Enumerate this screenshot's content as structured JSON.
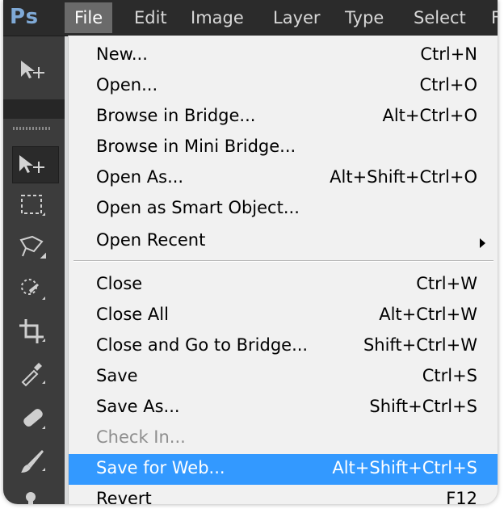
{
  "app": {
    "logo": "Ps"
  },
  "menubar": {
    "items": [
      {
        "label": "File",
        "active": true
      },
      {
        "label": "Edit"
      },
      {
        "label": "Image"
      },
      {
        "label": "Layer"
      },
      {
        "label": "Type"
      },
      {
        "label": "Select"
      },
      {
        "label": "F"
      }
    ]
  },
  "menu": {
    "group1": [
      {
        "label": "New...",
        "shortcut": "Ctrl+N"
      },
      {
        "label": "Open...",
        "shortcut": "Ctrl+O"
      },
      {
        "label": "Browse in Bridge...",
        "shortcut": "Alt+Ctrl+O"
      },
      {
        "label": "Browse in Mini Bridge...",
        "shortcut": ""
      },
      {
        "label": "Open As...",
        "shortcut": "Alt+Shift+Ctrl+O"
      },
      {
        "label": "Open as Smart Object...",
        "shortcut": ""
      },
      {
        "label": "Open Recent",
        "shortcut": ""
      }
    ],
    "group2": [
      {
        "label": "Close",
        "shortcut": "Ctrl+W"
      },
      {
        "label": "Close All",
        "shortcut": "Alt+Ctrl+W"
      },
      {
        "label": "Close and Go to Bridge...",
        "shortcut": "Shift+Ctrl+W"
      },
      {
        "label": "Save",
        "shortcut": "Ctrl+S"
      },
      {
        "label": "Save As...",
        "shortcut": "Shift+Ctrl+S"
      },
      {
        "label": "Check In...",
        "shortcut": "",
        "disabled": true
      },
      {
        "label": "Save for Web...",
        "shortcut": "Alt+Shift+Ctrl+S",
        "highlighted": true
      },
      {
        "label": "Revert",
        "shortcut": "F12"
      }
    ]
  },
  "colors": {
    "highlight": "#3399ff",
    "menubar": "#2b2b2b",
    "menu_bg": "#f1f1f1",
    "toolbar": "#3c3c3c"
  },
  "toolbar": {
    "icons": [
      "move-tool-icon",
      "move-tool-icon",
      "rectangular-marquee-icon",
      "lasso-icon",
      "quick-selection-icon",
      "crop-icon",
      "eyedropper-icon",
      "healing-brush-icon",
      "brush-icon",
      "clone-stamp-icon"
    ]
  }
}
